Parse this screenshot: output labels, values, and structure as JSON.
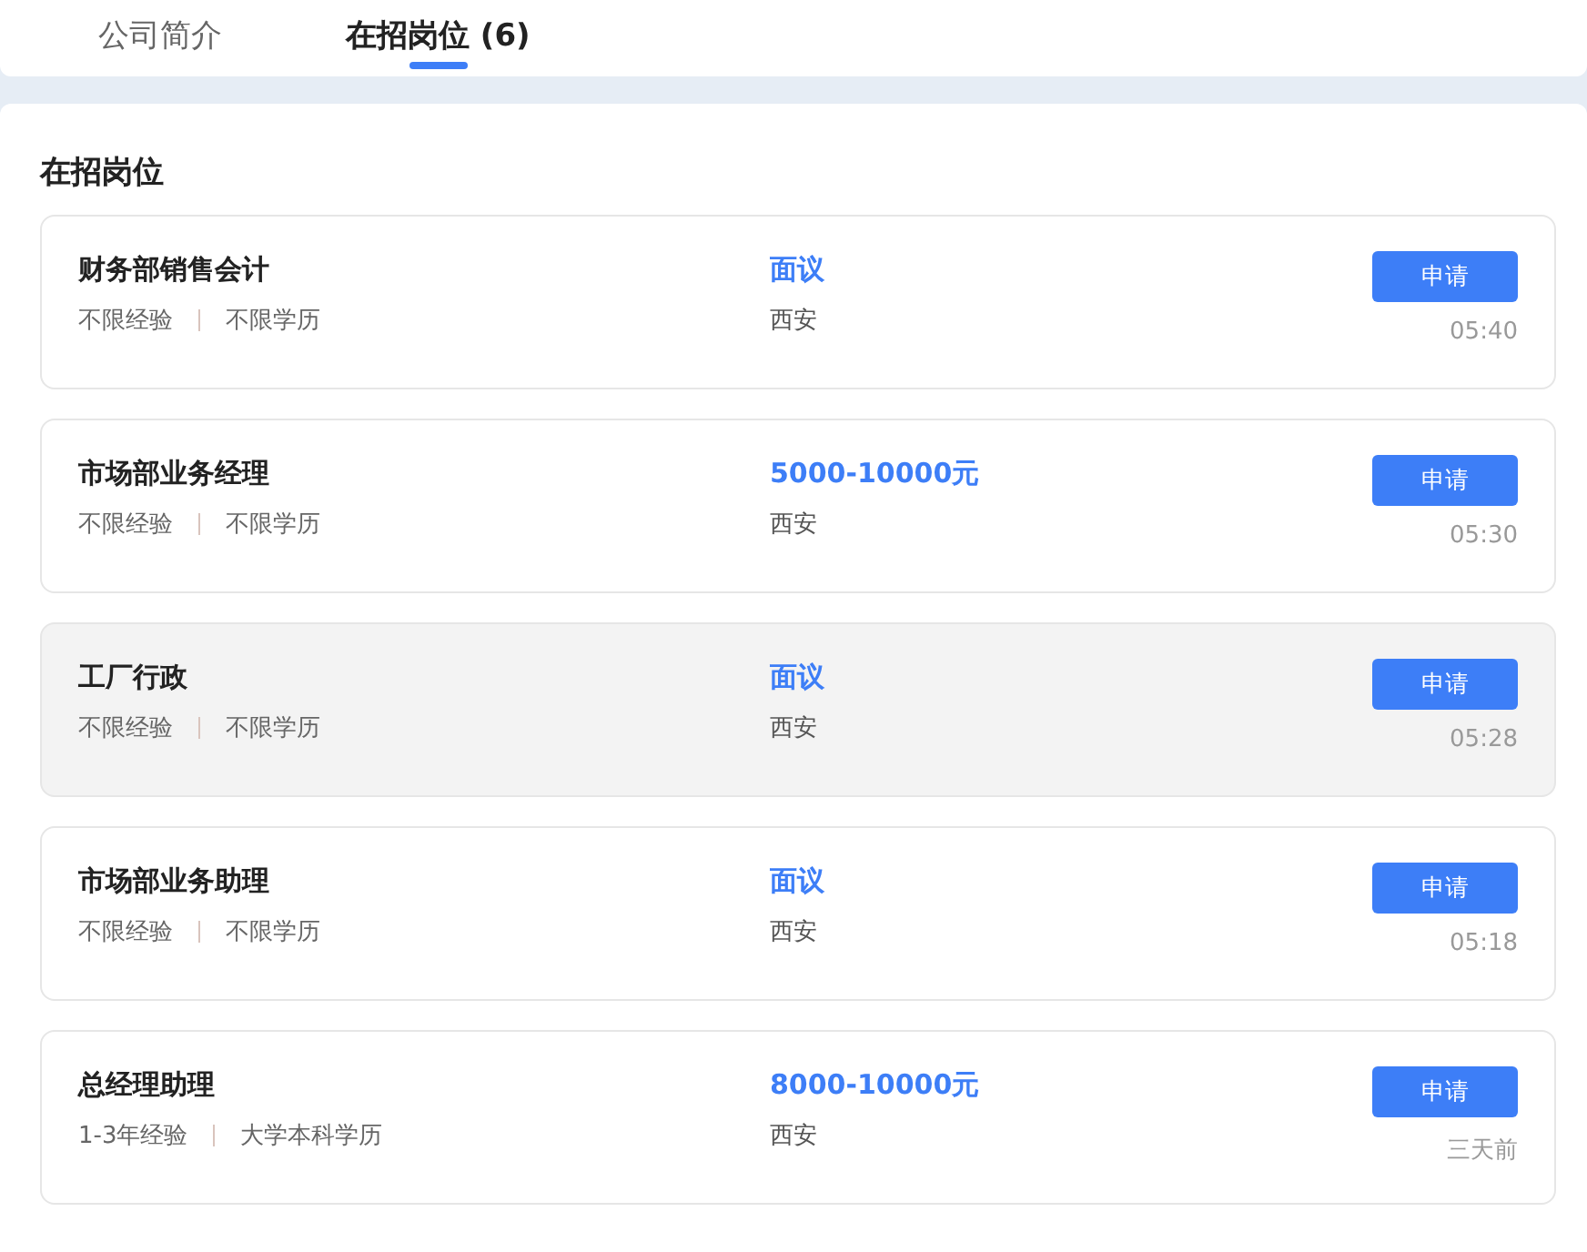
{
  "tabs": [
    {
      "label": "公司简介",
      "selected": false
    },
    {
      "label": "在招岗位 (6)",
      "selected": true
    }
  ],
  "section_title": "在招岗位",
  "jobs": [
    {
      "title": "财务部销售会计",
      "experience": "不限经验",
      "education": "不限学历",
      "salary": "面议",
      "location": "西安",
      "action": "申请",
      "time": "05:40",
      "highlighted": false
    },
    {
      "title": "市场部业务经理",
      "experience": "不限经验",
      "education": "不限学历",
      "salary": "5000-10000元",
      "location": "西安",
      "action": "申请",
      "time": "05:30",
      "highlighted": false
    },
    {
      "title": "工厂行政",
      "experience": "不限经验",
      "education": "不限学历",
      "salary": "面议",
      "location": "西安",
      "action": "申请",
      "time": "05:28",
      "highlighted": true
    },
    {
      "title": "市场部业务助理",
      "experience": "不限经验",
      "education": "不限学历",
      "salary": "面议",
      "location": "西安",
      "action": "申请",
      "time": "05:18",
      "highlighted": false
    },
    {
      "title": "总经理助理",
      "experience": "1-3年经验",
      "education": "大学本科学历",
      "salary": "8000-10000元",
      "location": "西安",
      "action": "申请",
      "time": "三天前",
      "highlighted": false
    }
  ]
}
